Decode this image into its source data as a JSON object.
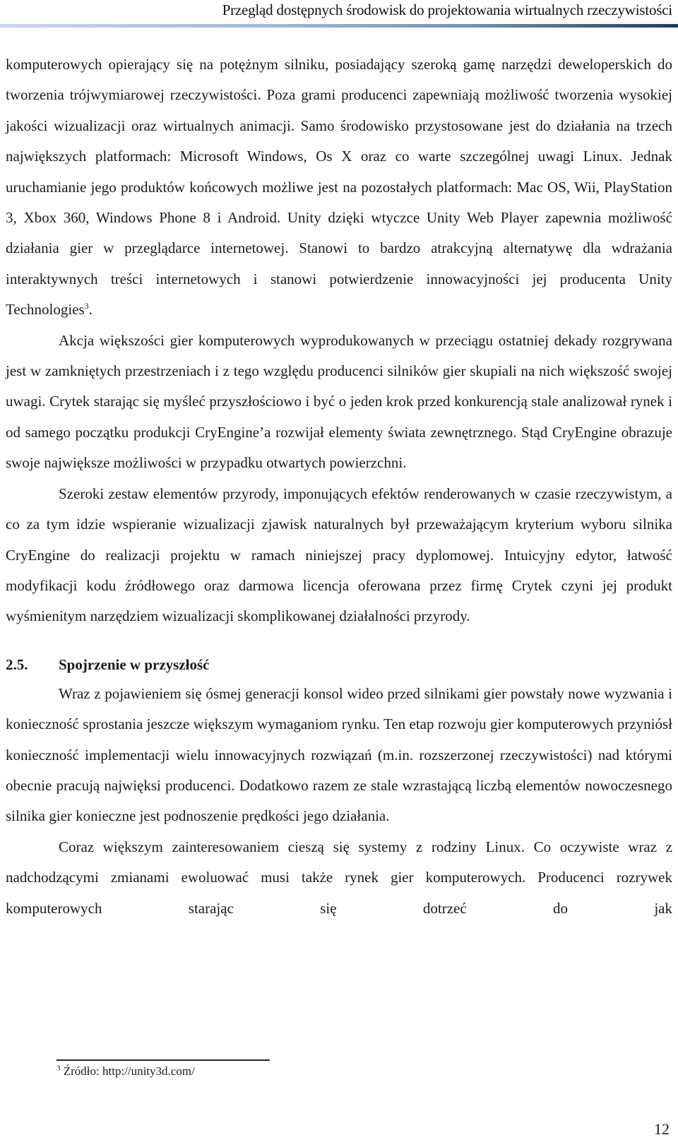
{
  "header": {
    "title": "Przegląd dostępnych środowisk do projektowania wirtualnych rzeczywistości"
  },
  "body": {
    "paragraph_1": "komputerowych opierający się na potężnym silniku, posiadający szeroką gamę narzędzi deweloperskich do tworzenia trójwymiarowej rzeczywistości. Poza grami producenci zapewniają możliwość tworzenia wysokiej jakości wizualizacji oraz wirtualnych animacji. Samo środowisko przystosowane jest do działania na trzech największych platformach: Microsoft Windows, Os X oraz co warte szczególnej uwagi Linux. Jednak uruchamianie jego produktów końcowych możliwe jest na pozostałych platformach: Mac OS, Wii, PlayStation 3, Xbox 360, Windows Phone 8 i Android. Unity dzięki wtyczce Unity Web Player zapewnia możliwość działania gier w przeglądarce internetowej. Stanowi to bardzo atrakcyjną alternatywę dla wdrażania interaktywnych treści internetowych i stanowi potwierdzenie innowacyjności jej producenta Unity Technologies",
    "paragraph_1_footnote_ref": "3",
    "paragraph_1_end": ".",
    "paragraph_2": "Akcja większości gier komputerowych wyprodukowanych w przeciągu ostatniej dekady rozgrywana jest w zamkniętych przestrzeniach i z tego względu producenci silników gier skupiali na nich większość swojej uwagi. Crytek starając się myśleć przyszłościowo i być o jeden krok przed konkurencją stale analizował rynek i od samego początku produkcji CryEngine’a rozwijał elementy świata zewnętrznego. Stąd CryEngine obrazuje swoje największe możliwości w przypadku otwartych powierzchni.",
    "paragraph_3": "Szeroki zestaw elementów przyrody, imponujących efektów renderowanych w czasie rzeczywistym, a co za tym idzie wspieranie wizualizacji zjawisk naturalnych był przeważającym kryterium wyboru silnika CryEngine do realizacji projektu w ramach niniejszej pracy dyplomowej. Intuicyjny edytor, łatwość modyfikacji kodu źródłowego oraz darmowa licencja oferowana przez firmę Crytek czyni jej produkt wyśmienitym narzędziem wizualizacji skomplikowanej działalności przyrody.",
    "section": {
      "number": "2.5.",
      "title": "Spojrzenie w przyszłość"
    },
    "paragraph_4": "Wraz z pojawieniem się ósmej generacji konsol wideo przed silnikami gier powstały nowe wyzwania i konieczność sprostania jeszcze większym wymaganiom rynku. Ten etap rozwoju gier komputerowych przyniósł konieczność implementacji wielu innowacyjnych rozwiązań (m.in. rozszerzonej rzeczywistości) nad którymi obecnie pracują najwięksi producenci. Dodatkowo razem ze stale wzrastającą liczbą elementów nowoczesnego silnika gier konieczne jest podnoszenie prędkości jego działania.",
    "paragraph_5": "Coraz większym zainteresowaniem cieszą się systemy z rodziny Linux. Co oczywiste wraz z nadchodzącymi zmianami ewoluować musi także rynek gier komputerowych. Producenci rozrywek komputerowych starając się dotrzeć do jak"
  },
  "footnote": {
    "marker": "3",
    "text": " Źródło: http://unity3d.com/"
  },
  "page_number": "12"
}
